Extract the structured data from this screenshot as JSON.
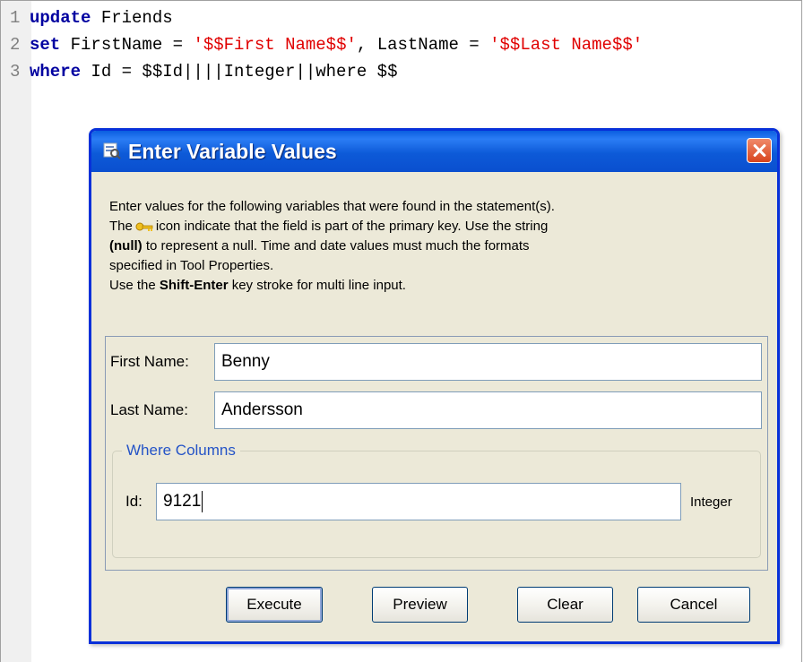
{
  "editor": {
    "lines": [
      {
        "num": "1",
        "kw": "update",
        "rest": " Friends",
        "str1": "",
        "mid": "",
        "str2": ""
      },
      {
        "num": "2",
        "kw": "set",
        "rest": " FirstName = ",
        "str1": "'$$First Name$$'",
        "mid": ", LastName = ",
        "str2": "'$$Last Name$$'"
      },
      {
        "num": "3",
        "kw": "where",
        "rest": " Id = $$Id||||Integer||where $$",
        "str1": "",
        "mid": "",
        "str2": ""
      }
    ]
  },
  "dialog": {
    "title": "Enter Variable Values",
    "info": {
      "line1": "Enter values for the following variables that were found in the statement(s).",
      "line2_pre": "The",
      "line2_post": "icon indicate that the field is part of the primary key. Use the string",
      "null_token": "(null)",
      "line3_post": "to represent a null. Time and date values must much the formats",
      "line4": "specified in Tool Properties.",
      "line5_pre": "Use the",
      "shift_enter": "Shift-Enter",
      "line5_post": "key stroke for multi line input."
    },
    "fields": {
      "first_name": {
        "label": "First Name:",
        "value": "Benny"
      },
      "last_name": {
        "label": "Last Name:",
        "value": "Andersson"
      }
    },
    "where_columns": {
      "legend": "Where Columns",
      "id": {
        "label": "Id:",
        "value": "9121",
        "type": "Integer"
      }
    },
    "buttons": {
      "execute": "Execute",
      "preview": "Preview",
      "clear": "Clear",
      "cancel": "Cancel"
    }
  }
}
